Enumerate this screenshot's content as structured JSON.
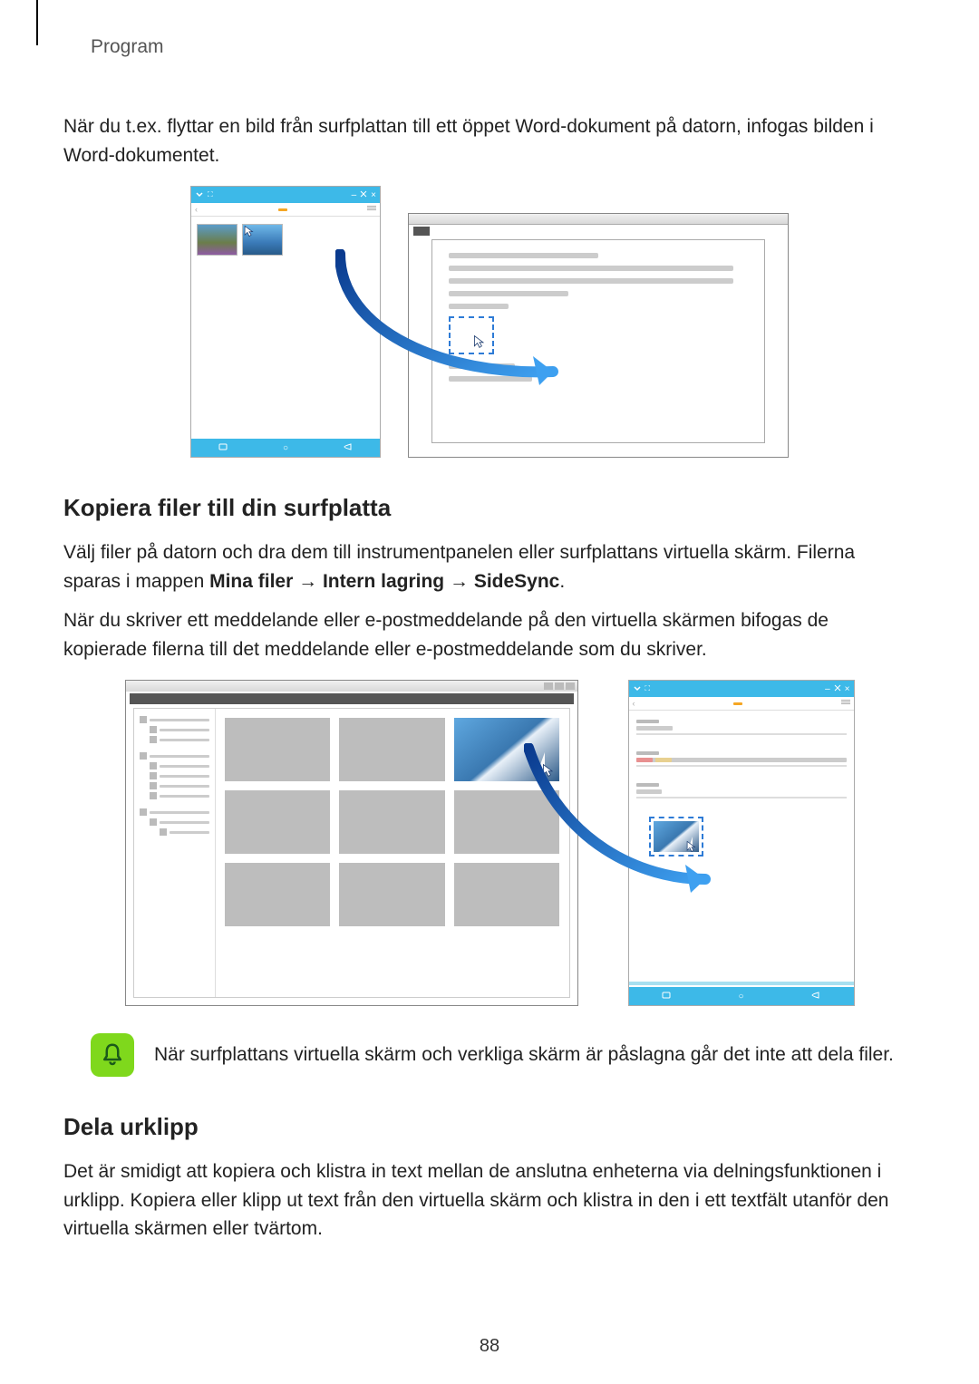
{
  "header": {
    "label": "Program"
  },
  "intro": "När du t.ex. flyttar en bild från surfplattan till ett öppet Word-dokument på datorn, infogas bilden i Word-dokumentet.",
  "section1": {
    "heading": "Kopiera filer till din surfplatta",
    "para1_a": "Välj filer på datorn och dra dem till instrumentpanelen eller surfplattans virtuella skärm. Filerna sparas i mappen ",
    "bold1": "Mina filer",
    "arrow": " → ",
    "bold2": "Intern lagring",
    "bold3": "SideSync",
    "period": ".",
    "para2": "När du skriver ett meddelande eller e-postmeddelande på den virtuella skärmen bifogas de kopierade filerna till det meddelande eller e-postmeddelande som du skriver."
  },
  "note": {
    "text": "När surfplattans virtuella skärm och verkliga skärm är påslagna går det inte att dela filer."
  },
  "section2": {
    "heading": "Dela urklipp",
    "para": "Det är smidigt att kopiera och klistra in text mellan de anslutna enheterna via delningsfunktionen i urklipp. Kopiera eller klipp ut text från den virtuella skärm och klistra in den i ett textfält utanför den virtuella skärmen eller tvärtom."
  },
  "pageNumber": "88"
}
